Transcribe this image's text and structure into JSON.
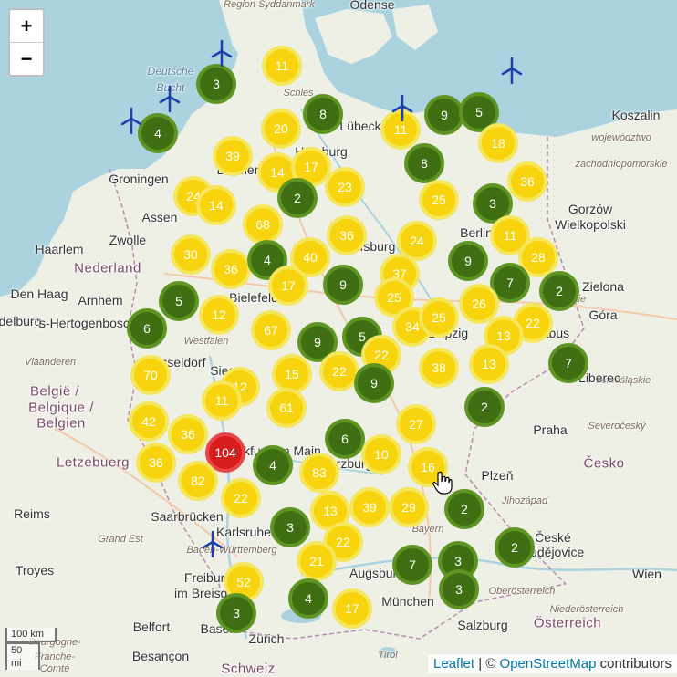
{
  "map": {
    "zoom_in_label": "+",
    "zoom_out_label": "−",
    "scale_metric": "100 km",
    "scale_imperial": "50 mi",
    "attribution": {
      "leaflet": "Leaflet",
      "separator": "| ©",
      "osm": "OpenStreetMap",
      "contributors": "contributors"
    },
    "colors": {
      "sea": "#aad3df",
      "land": "#eef0e6",
      "cluster_small": "#3f6f12",
      "cluster_medium": "#f7d40d",
      "cluster_large": "#d81d1d"
    },
    "place_labels": [
      {
        "text": "Region Syddanmark",
        "type": "region"
      },
      {
        "text": "Odense",
        "type": "city"
      },
      {
        "text": "Deutsche",
        "type": "sea"
      },
      {
        "text": "Bucht",
        "type": "sea"
      },
      {
        "text": "Schles",
        "type": "region"
      },
      {
        "text": "Lübeck",
        "type": "city"
      },
      {
        "text": "Hamburg",
        "type": "city"
      },
      {
        "text": "Koszalin",
        "type": "city"
      },
      {
        "text": "województwo",
        "type": "region"
      },
      {
        "text": "zachodniopomorskie",
        "type": "region"
      },
      {
        "text": "Groningen",
        "type": "city"
      },
      {
        "text": "Bremen",
        "type": "city"
      },
      {
        "text": "Gorzów",
        "type": "city"
      },
      {
        "text": "Wielkopolski",
        "type": "city"
      },
      {
        "text": "Assen",
        "type": "city"
      },
      {
        "text": "Zwolle",
        "type": "city"
      },
      {
        "text": "Haarlem",
        "type": "city"
      },
      {
        "text": "Nederland",
        "type": "country"
      },
      {
        "text": "Wolfsburg",
        "type": "city"
      },
      {
        "text": "Berlin",
        "type": "city"
      },
      {
        "text": "Den Haag",
        "type": "city"
      },
      {
        "text": "Arnhem",
        "type": "city"
      },
      {
        "text": "Bielefeld",
        "type": "city"
      },
      {
        "text": "lubuskie",
        "type": "region"
      },
      {
        "text": "Zielona",
        "type": "city"
      },
      {
        "text": "Góra",
        "type": "city"
      },
      {
        "text": "delburg",
        "type": "city"
      },
      {
        "text": "'s-Hertogenbosch",
        "type": "city"
      },
      {
        "text": "Leipzig",
        "type": "city"
      },
      {
        "text": "Cottbus",
        "type": "city"
      },
      {
        "text": "Westfalen",
        "type": "region"
      },
      {
        "text": "Vlaanderen",
        "type": "region"
      },
      {
        "text": "Düsseldorf",
        "type": "city"
      },
      {
        "text": "Siegen",
        "type": "city"
      },
      {
        "text": "dolnośląskie",
        "type": "region"
      },
      {
        "text": "België /",
        "type": "country"
      },
      {
        "text": "Belgique /",
        "type": "country"
      },
      {
        "text": "Belgien",
        "type": "country"
      },
      {
        "text": "Liberec",
        "type": "city"
      },
      {
        "text": "Severočeský",
        "type": "region"
      },
      {
        "text": "Praha",
        "type": "city"
      },
      {
        "text": "Letzebuerg",
        "type": "country"
      },
      {
        "text": "Frankfurt am Main",
        "type": "city"
      },
      {
        "text": "Würzburg",
        "type": "city"
      },
      {
        "text": "Plzeň",
        "type": "city"
      },
      {
        "text": "Česko",
        "type": "country"
      },
      {
        "text": "Saarbrücken",
        "type": "city"
      },
      {
        "text": "Jihozápad",
        "type": "region"
      },
      {
        "text": "Reims",
        "type": "city"
      },
      {
        "text": "Grand Est",
        "type": "region"
      },
      {
        "text": "Karlsruhe",
        "type": "city"
      },
      {
        "text": "Baden-Württemberg",
        "type": "region"
      },
      {
        "text": "Bayern",
        "type": "region"
      },
      {
        "text": "České",
        "type": "city"
      },
      {
        "text": "Budějovice",
        "type": "city"
      },
      {
        "text": "Troyes",
        "type": "city"
      },
      {
        "text": "Augsburg",
        "type": "city"
      },
      {
        "text": "Freiburg",
        "type": "city"
      },
      {
        "text": "im Breisgau",
        "type": "city"
      },
      {
        "text": "Oberösterreich",
        "type": "region"
      },
      {
        "text": "Wien",
        "type": "city"
      },
      {
        "text": "München",
        "type": "city"
      },
      {
        "text": "Niederösterreich",
        "type": "region"
      },
      {
        "text": "Belfort",
        "type": "city"
      },
      {
        "text": "Basel",
        "type": "city"
      },
      {
        "text": "Zürich",
        "type": "city"
      },
      {
        "text": "Salzburg",
        "type": "city"
      },
      {
        "text": "Österreich",
        "type": "country"
      },
      {
        "text": "Bourgogne-",
        "type": "region"
      },
      {
        "text": "Franche-",
        "type": "region"
      },
      {
        "text": "Comté",
        "type": "region"
      },
      {
        "text": "Besançon",
        "type": "city"
      },
      {
        "text": "Schweiz",
        "type": "country"
      },
      {
        "text": "Tirol",
        "type": "region"
      }
    ],
    "clusters": [
      {
        "count": "11",
        "level": "medium"
      },
      {
        "count": "3",
        "level": "small"
      },
      {
        "count": "4",
        "level": "small"
      },
      {
        "count": "20",
        "level": "medium"
      },
      {
        "count": "8",
        "level": "small"
      },
      {
        "count": "11",
        "level": "medium"
      },
      {
        "count": "9",
        "level": "small"
      },
      {
        "count": "5",
        "level": "small"
      },
      {
        "count": "18",
        "level": "medium"
      },
      {
        "count": "39",
        "level": "medium"
      },
      {
        "count": "14",
        "level": "medium"
      },
      {
        "count": "17",
        "level": "medium"
      },
      {
        "count": "8",
        "level": "small"
      },
      {
        "count": "36",
        "level": "medium"
      },
      {
        "count": "24",
        "level": "medium"
      },
      {
        "count": "14",
        "level": "medium"
      },
      {
        "count": "2",
        "level": "small"
      },
      {
        "count": "23",
        "level": "medium"
      },
      {
        "count": "25",
        "level": "medium"
      },
      {
        "count": "3",
        "level": "small"
      },
      {
        "count": "68",
        "level": "medium"
      },
      {
        "count": "36",
        "level": "medium"
      },
      {
        "count": "24",
        "level": "medium"
      },
      {
        "count": "11",
        "level": "medium"
      },
      {
        "count": "30",
        "level": "medium"
      },
      {
        "count": "36",
        "level": "medium"
      },
      {
        "count": "4",
        "level": "small"
      },
      {
        "count": "40",
        "level": "medium"
      },
      {
        "count": "9",
        "level": "small"
      },
      {
        "count": "28",
        "level": "medium"
      },
      {
        "count": "37",
        "level": "medium"
      },
      {
        "count": "17",
        "level": "medium"
      },
      {
        "count": "9",
        "level": "small"
      },
      {
        "count": "7",
        "level": "small"
      },
      {
        "count": "2",
        "level": "small"
      },
      {
        "count": "5",
        "level": "small"
      },
      {
        "count": "25",
        "level": "medium"
      },
      {
        "count": "26",
        "level": "medium"
      },
      {
        "count": "12",
        "level": "medium"
      },
      {
        "count": "6",
        "level": "small"
      },
      {
        "count": "67",
        "level": "medium"
      },
      {
        "count": "34",
        "level": "medium"
      },
      {
        "count": "25",
        "level": "medium"
      },
      {
        "count": "22",
        "level": "medium"
      },
      {
        "count": "9",
        "level": "small"
      },
      {
        "count": "5",
        "level": "small"
      },
      {
        "count": "13",
        "level": "medium"
      },
      {
        "count": "22",
        "level": "medium"
      },
      {
        "count": "70",
        "level": "medium"
      },
      {
        "count": "15",
        "level": "medium"
      },
      {
        "count": "22",
        "level": "medium"
      },
      {
        "count": "38",
        "level": "medium"
      },
      {
        "count": "13",
        "level": "medium"
      },
      {
        "count": "7",
        "level": "small"
      },
      {
        "count": "12",
        "level": "medium"
      },
      {
        "count": "9",
        "level": "small"
      },
      {
        "count": "11",
        "level": "medium"
      },
      {
        "count": "61",
        "level": "medium"
      },
      {
        "count": "2",
        "level": "small"
      },
      {
        "count": "42",
        "level": "medium"
      },
      {
        "count": "36",
        "level": "medium"
      },
      {
        "count": "27",
        "level": "medium"
      },
      {
        "count": "6",
        "level": "small"
      },
      {
        "count": "104",
        "level": "large"
      },
      {
        "count": "36",
        "level": "medium"
      },
      {
        "count": "10",
        "level": "medium"
      },
      {
        "count": "4",
        "level": "small"
      },
      {
        "count": "16",
        "level": "medium"
      },
      {
        "count": "83",
        "level": "medium"
      },
      {
        "count": "82",
        "level": "medium"
      },
      {
        "count": "22",
        "level": "medium"
      },
      {
        "count": "13",
        "level": "medium"
      },
      {
        "count": "39",
        "level": "medium"
      },
      {
        "count": "29",
        "level": "medium"
      },
      {
        "count": "2",
        "level": "small"
      },
      {
        "count": "3",
        "level": "small"
      },
      {
        "count": "22",
        "level": "medium"
      },
      {
        "count": "2",
        "level": "small"
      },
      {
        "count": "21",
        "level": "medium"
      },
      {
        "count": "7",
        "level": "small"
      },
      {
        "count": "3",
        "level": "small"
      },
      {
        "count": "52",
        "level": "medium"
      },
      {
        "count": "3",
        "level": "small"
      },
      {
        "count": "4",
        "level": "small"
      },
      {
        "count": "17",
        "level": "medium"
      },
      {
        "count": "3",
        "level": "small"
      }
    ],
    "turbine_markers": 6
  }
}
